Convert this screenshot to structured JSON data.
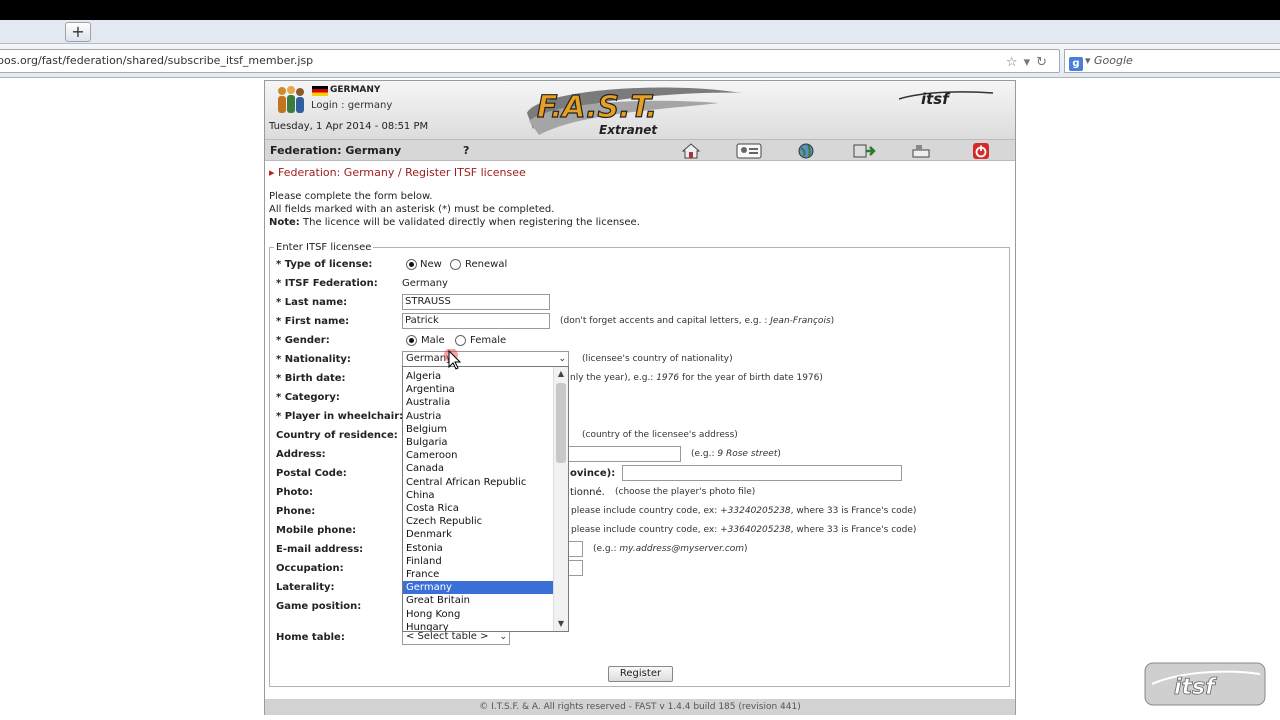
{
  "browser": {
    "new_tab_label": "+",
    "url": "pos.org/fast/federation/shared/subscribe_itsf_member.jsp",
    "search_placeholder": "Google",
    "search_engine_icon": "g-icon"
  },
  "header": {
    "country": "GERMANY",
    "login": "Login : germany",
    "datetime": "Tuesday, 1 Apr 2014 - 08:51 PM",
    "logo_main": "F.A.S.T.",
    "logo_sub": "Extranet",
    "logo_itsf": "itsf"
  },
  "fedbar": {
    "title": "Federation: Germany",
    "help": "?",
    "icons": [
      "home-icon",
      "id-card-icon",
      "globe-icon",
      "transfer-icon",
      "tools-icon",
      "power-icon"
    ]
  },
  "breadcrumb": {
    "arrow": "▸",
    "text": "Federation: Germany / Register ITSF licensee"
  },
  "intro": {
    "line1": "Please complete the form below.",
    "line2": "All fields marked with an asterisk (*) must be completed.",
    "note_label": "Note:",
    "note_text": " The licence will be validated directly when registering the licensee."
  },
  "form": {
    "legend": "Enter ITSF licensee",
    "labels": {
      "type": "* Type of license:",
      "federation": "* ITSF Federation:",
      "lastname": "* Last name:",
      "firstname": "* First name:",
      "gender": "* Gender:",
      "nationality": "* Nationality:",
      "birthdate": "* Birth date:",
      "category": "* Category:",
      "wheelchair": "* Player in wheelchair:",
      "residence": "Country of residence:",
      "address": "Address:",
      "postal": "Postal Code:",
      "photo": "Photo:",
      "phone": "Phone:",
      "mobile": "Mobile phone:",
      "email": "E-mail address:",
      "occupation": "Occupation:",
      "laterality": "Laterality:",
      "position": "Game position:",
      "hometable": "Home table:"
    },
    "type_new": "New",
    "type_renewal": "Renewal",
    "federation_value": "Germany",
    "lastname_value": "STRAUSS",
    "firstname_value": "Patrick",
    "firstname_hint": "(don't forget accents and capital letters, e.g. : ",
    "firstname_hint_example": "Jean-François",
    "firstname_hint_end": ")",
    "gender_male": "Male",
    "gender_female": "Female",
    "nationality_value": "Germany",
    "nationality_hint": "(licensee's country of nationality)",
    "birth_hint_pre": "nly the year), e.g.: ",
    "birth_hint_example": "1976",
    "birth_hint_post": " for the year of birth date 1976)",
    "residence_hint": "(country of the licensee's address)",
    "address_hint_pre": "(e.g.: ",
    "address_hint_example": "9 Rose street",
    "address_hint_post": ")",
    "province_label": "ovince):",
    "photo_partial": "tionné.",
    "photo_hint": "(choose the player's photo file)",
    "phone_hint_pre": "please include country code, ex: ",
    "phone_hint_example": "+33240205238",
    "phone_hint_post": ", where 33 is France's code)",
    "mobile_hint_pre": "please include country code, ex: ",
    "mobile_hint_example": "+33640205238",
    "mobile_hint_post": ", where 33 is France's code)",
    "email_hint_pre": "(e.g.: ",
    "email_hint_example": "my.address@myserver.com",
    "email_hint_post": ")",
    "hometable_value": "< Select table >",
    "register": "Register"
  },
  "nationality_options": [
    "Algeria",
    "Argentina",
    "Australia",
    "Austria",
    "Belgium",
    "Bulgaria",
    "Cameroon",
    "Canada",
    "Central African Republic",
    "China",
    "Costa Rica",
    "Czech Republic",
    "Denmark",
    "Estonia",
    "Finland",
    "France",
    "Germany",
    "Great Britain",
    "Hong Kong",
    "Hungary"
  ],
  "nationality_selected": "Germany",
  "footer": "© I.T.S.F. & A. All rights reserved - FAST v 1.4.4 build 185 (revision 441)",
  "watermark": "itsf"
}
